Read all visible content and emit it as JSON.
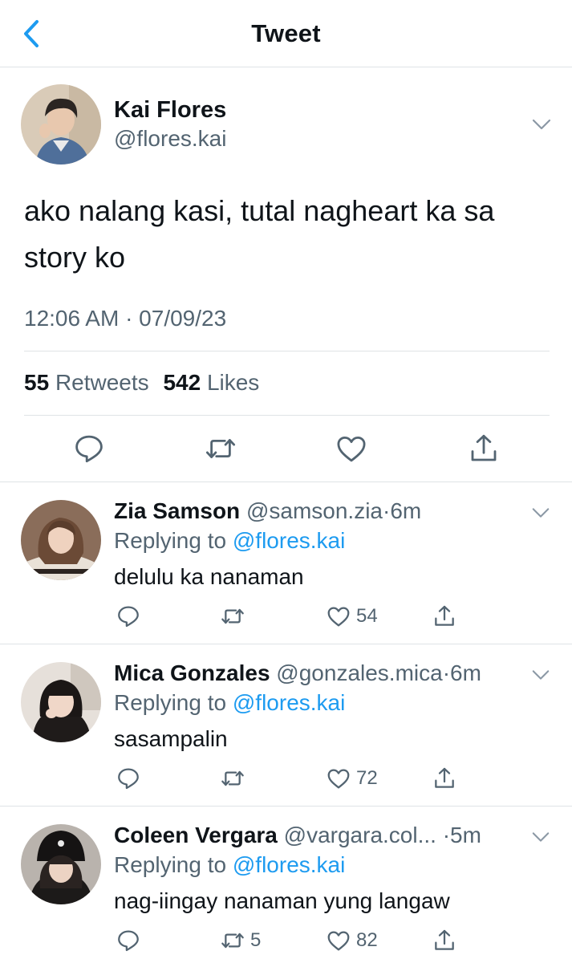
{
  "header": {
    "title": "Tweet"
  },
  "main_tweet": {
    "name": "Kai Flores",
    "handle": "@flores.kai",
    "text": "ako nalang kasi, tutal nagheart ka sa story ko",
    "timestamp": "12:06 AM · 07/09/23",
    "retweets": {
      "count": "55",
      "label": "Retweets"
    },
    "likes": {
      "count": "542",
      "label": "Likes"
    }
  },
  "replies": [
    {
      "name": "Zia Samson",
      "handle": "@samson.zia",
      "dot": "·",
      "time": "6m",
      "replying_prefix": "Replying to",
      "replying_to": "@flores.kai",
      "text": "delulu ka nanaman",
      "retweets": "",
      "likes": "54"
    },
    {
      "name": "Mica Gonzales",
      "handle": "@gonzales.mica",
      "dot": "·",
      "time": "6m",
      "replying_prefix": "Replying to",
      "replying_to": "@flores.kai",
      "text": "sasampalin",
      "retweets": "",
      "likes": "72"
    },
    {
      "name": "Coleen Vergara",
      "handle": "@vargara.col...",
      "dot": "·",
      "time": "5m",
      "replying_prefix": "Replying to",
      "replying_to": "@flores.kai",
      "text": "nag-iingay nanaman yung langaw",
      "retweets": "5",
      "likes": "82"
    }
  ],
  "colors": {
    "accent": "#1d9bf0",
    "text_primary": "#0f1419",
    "text_secondary": "#536471",
    "divider": "#dfe3e6",
    "icon": "#536471"
  },
  "icons": [
    "back-chevron-icon",
    "chevron-down-icon",
    "reply-icon",
    "retweet-icon",
    "like-icon",
    "share-icon"
  ]
}
